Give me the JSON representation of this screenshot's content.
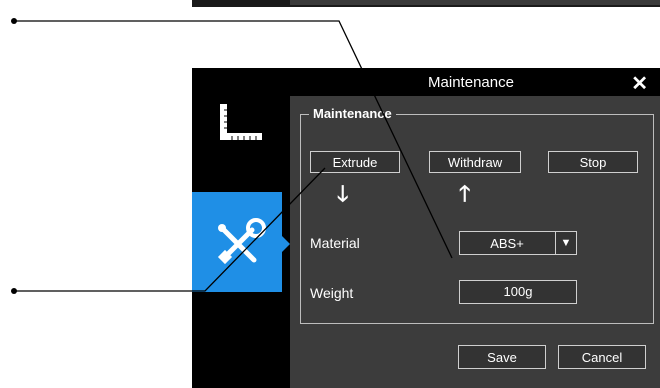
{
  "window": {
    "title": "Maintenance",
    "close_glyph": "✕"
  },
  "sidebar": {
    "items": [
      {
        "icon": "ruler-icon",
        "active": false
      },
      {
        "icon": "tools-icon",
        "active": true
      }
    ],
    "active_color": "#1f8fe6"
  },
  "maintenance": {
    "group_title": "Maintenance",
    "buttons": {
      "extrude": "Extrude",
      "withdraw": "Withdraw",
      "stop": "Stop"
    },
    "arrows": {
      "extrude": "down-arrow-icon",
      "withdraw": "up-arrow-icon"
    },
    "material": {
      "label": "Material",
      "value": "ABS+"
    },
    "weight": {
      "label": "Weight",
      "value": "100g"
    }
  },
  "footer": {
    "save": "Save",
    "cancel": "Cancel"
  }
}
